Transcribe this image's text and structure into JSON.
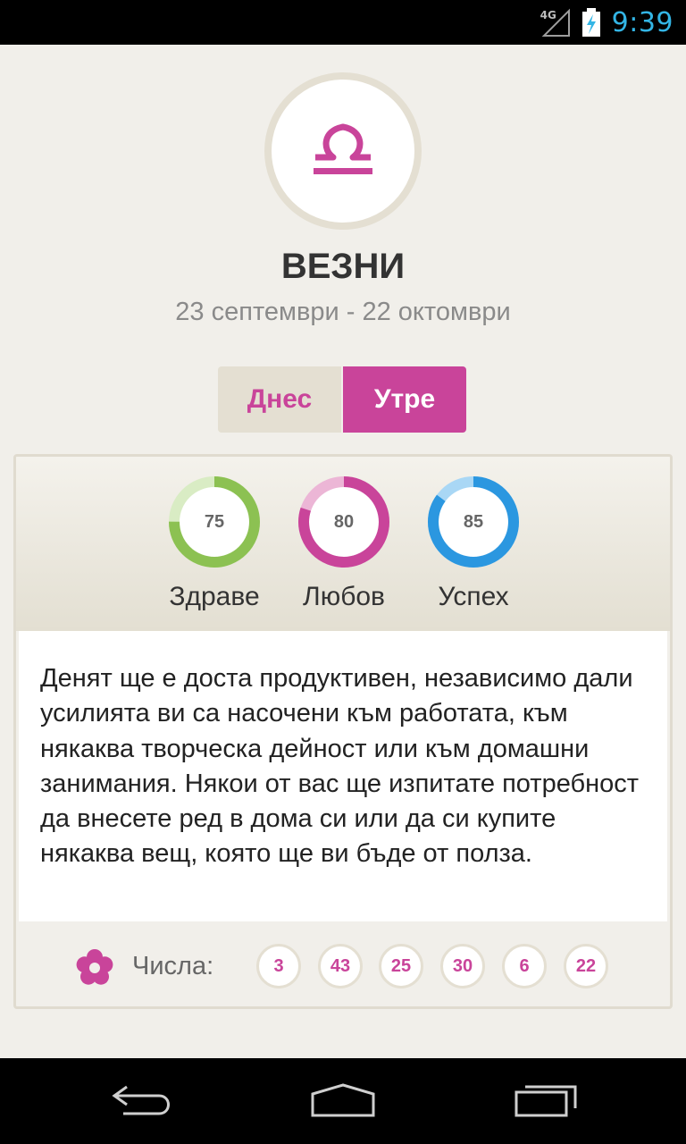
{
  "status_bar": {
    "network": "4G",
    "time": "9:39"
  },
  "header": {
    "icon": "libra-icon",
    "title": "ВЕЗНИ",
    "dates": "23 септември - 22 октомври"
  },
  "tabs": [
    {
      "label": "Днес",
      "selected": false
    },
    {
      "label": "Утре",
      "selected": true
    }
  ],
  "meters": [
    {
      "label": "Здраве",
      "value": "75",
      "percent": 75,
      "color": "#8cc152",
      "track": "#d9ecc4"
    },
    {
      "label": "Любов",
      "value": "80",
      "percent": 80,
      "color": "#c9449a",
      "track": "#ecb6d6"
    },
    {
      "label": "Успех",
      "value": "85",
      "percent": 85,
      "color": "#2b97e0",
      "track": "#a9d7f5"
    }
  ],
  "forecast": "Денят ще е доста продуктивен, независимо дали усилията ви са насочени към работата, към някаква творческа дейност или към домашни занимания. Някои от вас ще изпитате потребност да внесете ред в дома си или да си купите някаква вещ, която ще ви бъде от полза.",
  "numbers": {
    "icon": "flower-icon",
    "label": "Числа:",
    "values": [
      "3",
      "43",
      "25",
      "30",
      "6",
      "22"
    ]
  },
  "colors": {
    "accent": "#c9449a",
    "background": "#f1efea"
  }
}
